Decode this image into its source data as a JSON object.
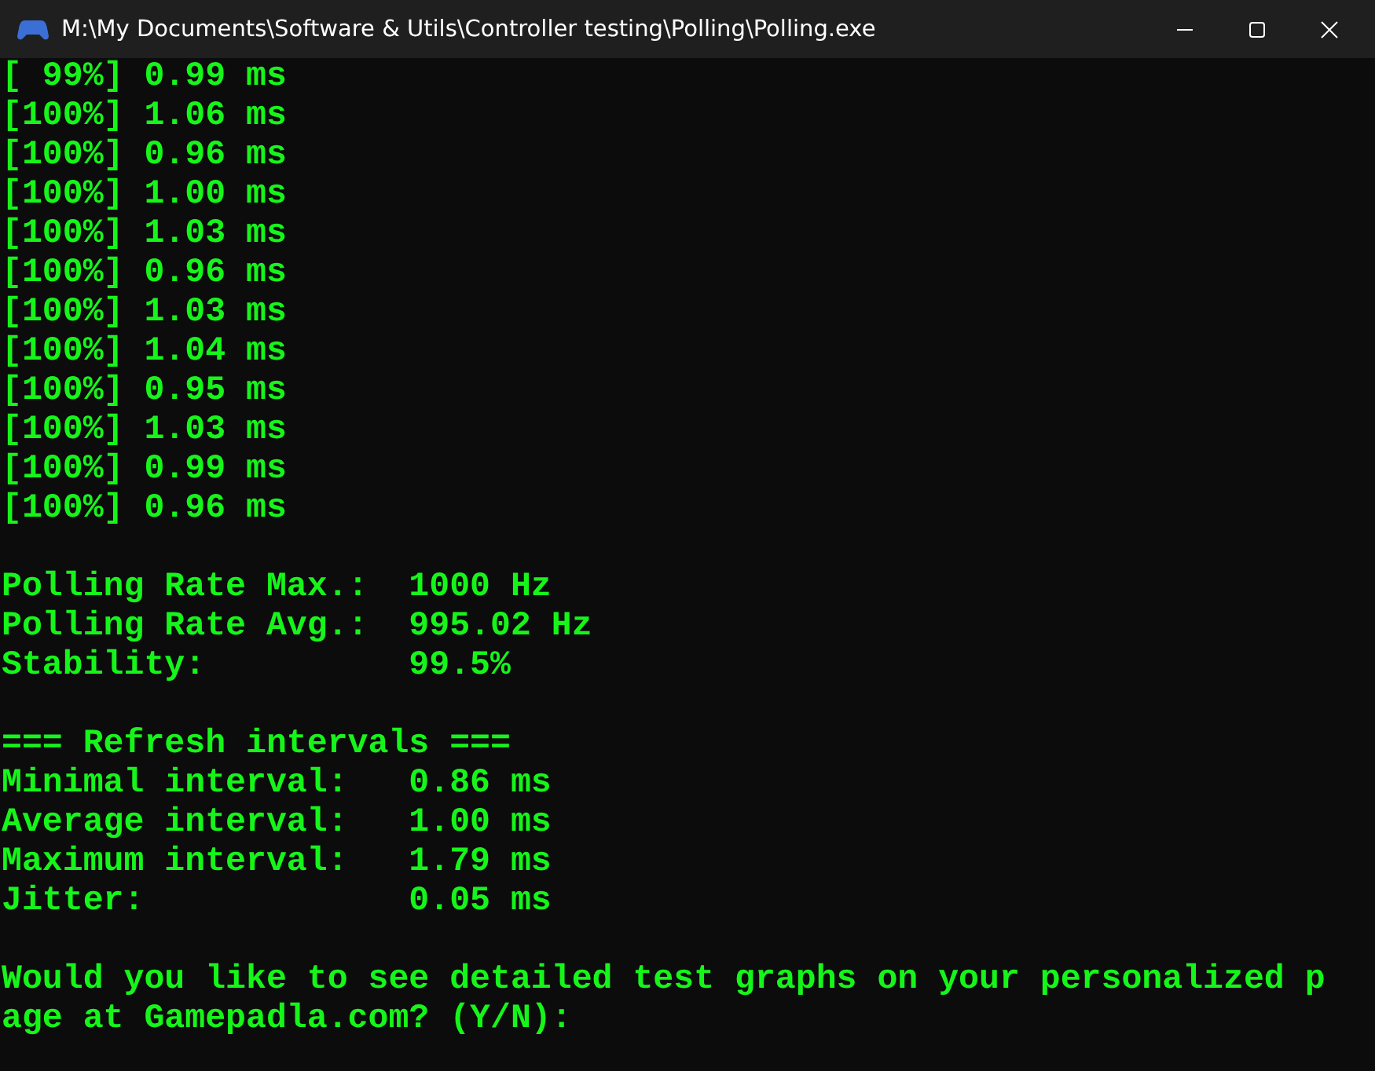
{
  "window": {
    "title": "M:\\My Documents\\Software & Utils\\Controller testing\\Polling\\Polling.exe"
  },
  "readings": [
    "[ 99%] 0.99 ms",
    "[100%] 1.06 ms",
    "[100%] 0.96 ms",
    "[100%] 1.00 ms",
    "[100%] 1.03 ms",
    "[100%] 0.96 ms",
    "[100%] 1.03 ms",
    "[100%] 1.04 ms",
    "[100%] 0.95 ms",
    "[100%] 1.03 ms",
    "[100%] 0.99 ms",
    "[100%] 0.96 ms"
  ],
  "rate_stats": [
    "Polling Rate Max.:  1000 Hz",
    "Polling Rate Avg.:  995.02 Hz",
    "Stability:          99.5%"
  ],
  "intervals_heading": "=== Refresh intervals ===",
  "intervals": [
    "Minimal interval:   0.86 ms",
    "Average interval:   1.00 ms",
    "Maximum interval:   1.79 ms",
    "Jitter:             0.05 ms"
  ],
  "prompt_lines": [
    "Would you like to see detailed test graphs on your personalized p",
    "age at Gamepadla.com? (Y/N):"
  ]
}
